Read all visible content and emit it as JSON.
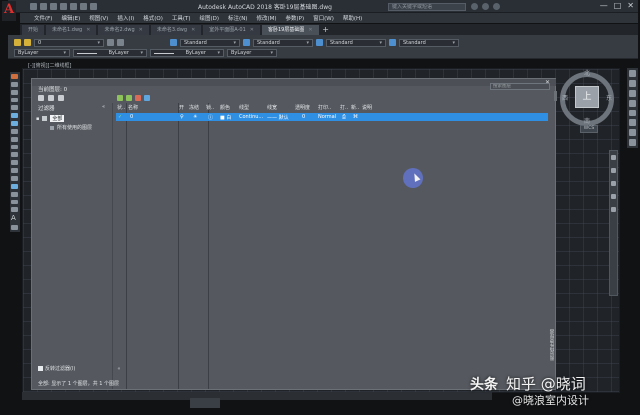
{
  "app": {
    "logo_letter": "A",
    "title": "Autodesk AutoCAD 2018    客卧19层基础图.dwg",
    "search_placeholder": "键入关键字或短语",
    "window_controls": [
      "—",
      "□",
      "✕"
    ]
  },
  "menu": [
    "文件(F)",
    "编辑(E)",
    "视图(V)",
    "插入(I)",
    "格式(O)",
    "工具(T)",
    "绘图(D)",
    "标注(N)",
    "修改(M)",
    "参数(P)",
    "窗口(W)",
    "帮助(H)"
  ],
  "tabs": [
    {
      "label": "开始",
      "active": false
    },
    {
      "label": "未命名1.dwg",
      "active": false
    },
    {
      "label": "未命名2.dwg",
      "active": false
    },
    {
      "label": "未命名3.dwg",
      "active": false
    },
    {
      "label": "室外平面图A-01",
      "active": false
    },
    {
      "label": "客卧19层基础图",
      "active": true
    }
  ],
  "ribbon": {
    "layer_combo": "0",
    "text_style": "Standard",
    "dim_style": "Standard",
    "table_style": "Standard",
    "multileader_style": "Standard",
    "color_combo": "ByLayer",
    "linetype_combo": "ByLayer",
    "lineweight_combo": "ByLayer",
    "plotstyle_combo": "ByLayer"
  },
  "viewport_label": "[-][俯视][二维线框]",
  "viewcube": {
    "face": "上",
    "north": "北",
    "south": "南",
    "east": "东",
    "west": "西",
    "wcs": "WCS"
  },
  "palette": {
    "current_layer": "当前图层: 0",
    "search_placeholder": "搜索图层",
    "close_symbol": "✕",
    "filter_header": "过滤器",
    "filter_collapse": "«",
    "tree": {
      "root": "全部",
      "child": "所有使用的图层"
    },
    "columns": [
      "状..",
      "名称",
      "开",
      "冻结",
      "锁..",
      "颜色",
      "线型",
      "线宽",
      "透明度",
      "打印..",
      "打..",
      "新..",
      "说明"
    ],
    "rows": [
      {
        "status": "✓",
        "name": "0",
        "on": "♀",
        "freeze": "☀",
        "lock": "ⓘ",
        "color": "■ 白",
        "linetype": "Continu...",
        "lineweight": "—— 默认",
        "transparency": "0",
        "plot_style": "Normal",
        "plot": "⎙",
        "new_vp_freeze": "⌘",
        "description": ""
      }
    ],
    "invert_filter": "反转过滤器(I)",
    "invert_collapse": "«",
    "status_text": "全部: 显示了 1 个图层，共 1 个图层",
    "side_label": "图层特性管理器"
  },
  "watermark": {
    "left": "头条",
    "right": "知乎 @晓词",
    "sub": "@晓浪室内设计"
  }
}
